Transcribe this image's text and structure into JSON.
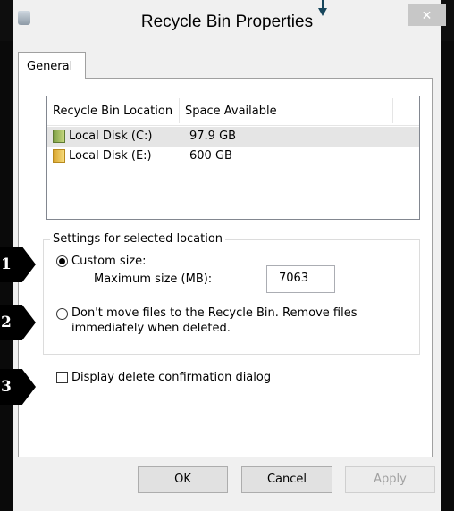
{
  "window": {
    "title": "Recycle Bin Properties",
    "close_glyph": "✕"
  },
  "tabs": [
    {
      "label": "General",
      "selected": true
    }
  ],
  "locations": {
    "columns": [
      "Recycle Bin Location",
      "Space Available"
    ],
    "rows": [
      {
        "name": "Local Disk (C:)",
        "space": "97.9 GB",
        "icon": "drive-icon",
        "selected": true
      },
      {
        "name": "Local Disk (E:)",
        "space": "600 GB",
        "icon": "folder-icon",
        "selected": false
      }
    ]
  },
  "settings": {
    "legend": "Settings for selected location",
    "custom_size_label": "Custom size:",
    "custom_size_selected": true,
    "max_size_label": "Maximum size (MB):",
    "max_size_value": "7063",
    "no_recycle_label_line1": "Don't move files to the Recycle Bin. Remove files",
    "no_recycle_label_line2": "immediately when deleted.",
    "no_recycle_selected": false
  },
  "confirm": {
    "label": "Display delete confirmation dialog",
    "checked": false
  },
  "buttons": {
    "ok": "OK",
    "cancel": "Cancel",
    "apply": "Apply"
  },
  "badges": [
    "1",
    "2",
    "3"
  ]
}
